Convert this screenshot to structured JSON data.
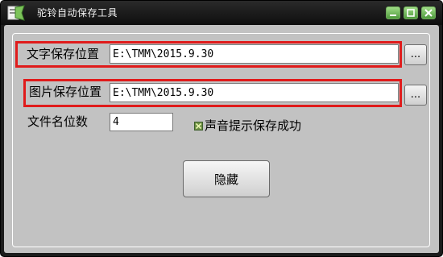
{
  "window": {
    "title": "驼铃自动保存工具",
    "controls": {
      "minimize_icon": "minimize-icon",
      "maximize_icon": "maximize-icon",
      "close_icon": "close-icon"
    }
  },
  "form": {
    "text_path": {
      "label": "文字保存位置",
      "value": "E:\\TMM\\2015.9.30",
      "browse_label": "..."
    },
    "image_path": {
      "label": "图片保存位置",
      "value": "E:\\TMM\\2015.9.30",
      "browse_label": "..."
    },
    "filename_digits": {
      "label": "文件名位数",
      "value": "4"
    },
    "sound_notify": {
      "label": "声音提示保存成功",
      "checked": true
    },
    "hide_button": {
      "label": "隐藏"
    }
  },
  "colors": {
    "highlight": "#e01b1b",
    "client_background": "#c2c2c2",
    "titlebar": "#1b1b1b",
    "window_button": "#6fb557"
  }
}
